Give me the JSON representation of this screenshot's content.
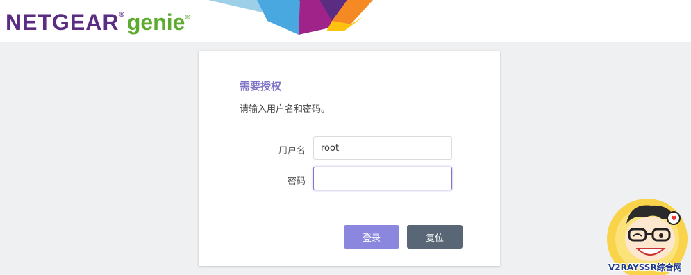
{
  "header": {
    "brand": "NETGEAR",
    "reg_mark": "®",
    "product": "genie",
    "product_reg_mark": "®"
  },
  "auth": {
    "title": "需要授权",
    "description": "请输入用户名和密码。",
    "username_label": "用户名",
    "username_value": "root",
    "password_label": "密码",
    "password_value": "",
    "login_button": "登录",
    "reset_button": "复位"
  },
  "watermark": {
    "text": "V2RAYSSR综合网"
  },
  "colors": {
    "brand_purple": "#5a2d82",
    "brand_green": "#5bab2e",
    "accent": "#7e74c8",
    "login_button": "#8b87df",
    "reset_button": "#596675",
    "background": "#eef0f1"
  }
}
